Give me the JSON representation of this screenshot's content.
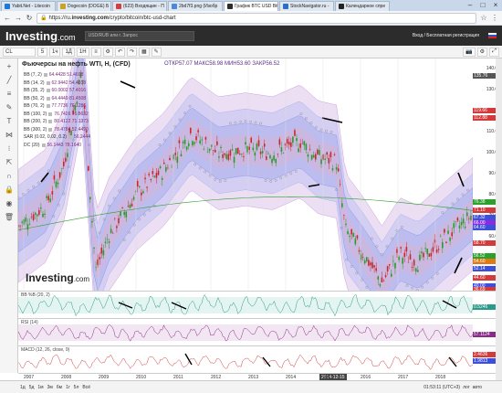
{
  "browser": {
    "tabs": [
      {
        "label": "Yabit.Net - Litecoin",
        "color": "#1d7ad8",
        "active": false
      },
      {
        "label": "Dogecoin (DOGE) Б",
        "color": "#c9a227",
        "active": false
      },
      {
        "label": "(623) Входящие - П",
        "color": "#d04040",
        "active": false
      },
      {
        "label": "2bd7f3.png (Изобр",
        "color": "#4a8ad8",
        "active": false
      },
      {
        "label": "График BTC USD Bit",
        "color": "#2c2c2c",
        "active": true
      },
      {
        "label": "StockNavigator.ru -",
        "color": "#2d6fc0",
        "active": false
      },
      {
        "label": "Календарное спре",
        "color": "#222222",
        "active": false
      }
    ],
    "url": "https://ru.investing.com/crypto/bitcoin/btc-usd-chart",
    "url_prefix": "https://ru.",
    "url_domain": "investing.com",
    "url_path": "/crypto/bitcoin/btc-usd-chart"
  },
  "site": {
    "logo": "Investing",
    "logo_suffix": ".com",
    "search_placeholder": "USD/RUB или г. Запрос",
    "login": "Вход / Бесплатная регистрация"
  },
  "toolbar": {
    "symbol": "CL",
    "intervals": [
      "5",
      "1ч",
      "1Д",
      "1Н"
    ],
    "buttons": [
      "≡",
      "⚙",
      "↶",
      "↷",
      "▦",
      "✎"
    ]
  },
  "chart": {
    "title": "Фьючерсы на нефть WTI, Н, (CFD)",
    "ohlc": "ОТКР57.07  МАКС58.98  МИН53.60  ЗАКР56.52",
    "watermark": "Investing",
    "watermark_suffix": ".com",
    "legend": [
      {
        "name": "BB (7, 2)",
        "vals": "64.4428  51.4608"
      },
      {
        "name": "BB (14, 2)",
        "vals": "62.9442  54.4038"
      },
      {
        "name": "BB (35, 2)",
        "vals": "60.0002  57.4016"
      },
      {
        "name": "BB (50, 2)",
        "vals": "64.4449  81.4508"
      },
      {
        "name": "BB (70, 2)",
        "vals": "77.7736  76.1286"
      },
      {
        "name": "BB (100, 2)",
        "vals": "76.7426  76.5632"
      },
      {
        "name": "BB (200, 2)",
        "vals": "80.4122  71.1373"
      },
      {
        "name": "BB (300, 2)",
        "vals": "78.4784  52.4490"
      },
      {
        "name": "SAR (0.02, 0.02, 0.2)",
        "vals": "56.2444"
      },
      {
        "name": "DC (20)",
        "vals": "56.1443  78.1640"
      }
    ],
    "price_labels": [
      "140.00",
      "130.00",
      "120.00",
      "110.00",
      "100.00",
      "90.00",
      "80.00",
      "70.00",
      "60.00",
      "50.00",
      "40.00"
    ],
    "price_tags": [
      {
        "label": "135.76",
        "color": "#555555"
      },
      {
        "label": "119.66",
        "color": "#d43a3a"
      },
      {
        "label": "112.88",
        "color": "#d43a3a"
      },
      {
        "label": "76.38",
        "color": "#2ca02c"
      },
      {
        "label": "71.10",
        "color": "#d43a3a"
      },
      {
        "label": "67.32",
        "color": "#3d4ed8"
      },
      {
        "label": "66.00",
        "color": "#8a2be2"
      },
      {
        "label": "64.60",
        "color": "#3d4ed8"
      },
      {
        "label": "58.70",
        "color": "#d43a3a"
      },
      {
        "label": "56.52",
        "color": "#2ca02c"
      },
      {
        "label": "54.60",
        "color": "#e07a10"
      },
      {
        "label": "52.14",
        "color": "#3d4ed8"
      },
      {
        "label": "44.60",
        "color": "#d43a3a"
      },
      {
        "label": "40.00",
        "color": "#3d4ed8"
      },
      {
        "label": "36.69",
        "color": "#d43a3a"
      }
    ],
    "indicators": [
      {
        "label": "BB %B (20, 2)",
        "value": "0.5246",
        "vcolor": "#2a9a8a"
      },
      {
        "label": "RSI (14)",
        "value": "57.1124",
        "vcolor": "#8a2a8a"
      },
      {
        "label": "MACD (12, 26, close, 9)",
        "value": "2.4636",
        "vcolor": "#d43a3a"
      }
    ],
    "macd_second": "1.9813",
    "x_labels": [
      "2007",
      "2008",
      "2009",
      "2010",
      "2011",
      "2012",
      "2013",
      "2014",
      "2015",
      "2016",
      "2017",
      "2018"
    ],
    "x_highlight": "2014-12-15"
  },
  "bottom": {
    "ranges": [
      "1д",
      "5д",
      "1м",
      "3м",
      "6м",
      "1г",
      "5л",
      "Всё"
    ],
    "clock": "01:53:11 (UTC+3)",
    "log": "лог",
    "auto": "авто"
  }
}
